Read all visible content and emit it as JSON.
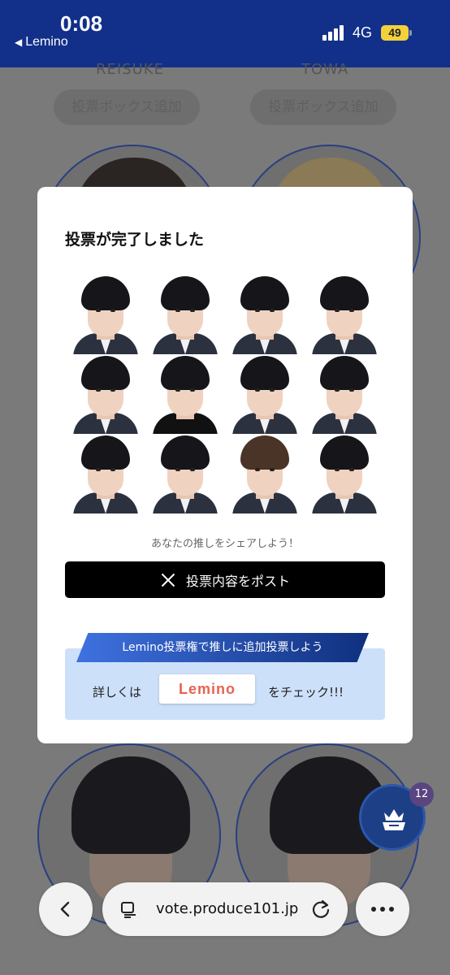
{
  "status_bar": {
    "time": "0:08",
    "back_app": "Lemino",
    "network": "4G",
    "battery": "49"
  },
  "background": {
    "left_name": "REISUKE",
    "right_name": "TOWA",
    "add_button_label": "投票ボックス追加"
  },
  "modal": {
    "title": "投票が完了しました",
    "share_prompt": "あなたの推しをシェアしよう！",
    "post_button_label": "投票内容をポスト",
    "promo": {
      "banner": "Lemino投票権で推しに追加投票しよう",
      "pre_text": "詳しくは",
      "logo_text": "Lemino",
      "post_text": "をチェック!!!"
    }
  },
  "fab": {
    "badge_count": "12"
  },
  "browser": {
    "url": "vote.produce101.jp"
  },
  "colors": {
    "status_bar": "#12308a",
    "post_button": "#000000",
    "promo_bg": "#cde0fa"
  }
}
